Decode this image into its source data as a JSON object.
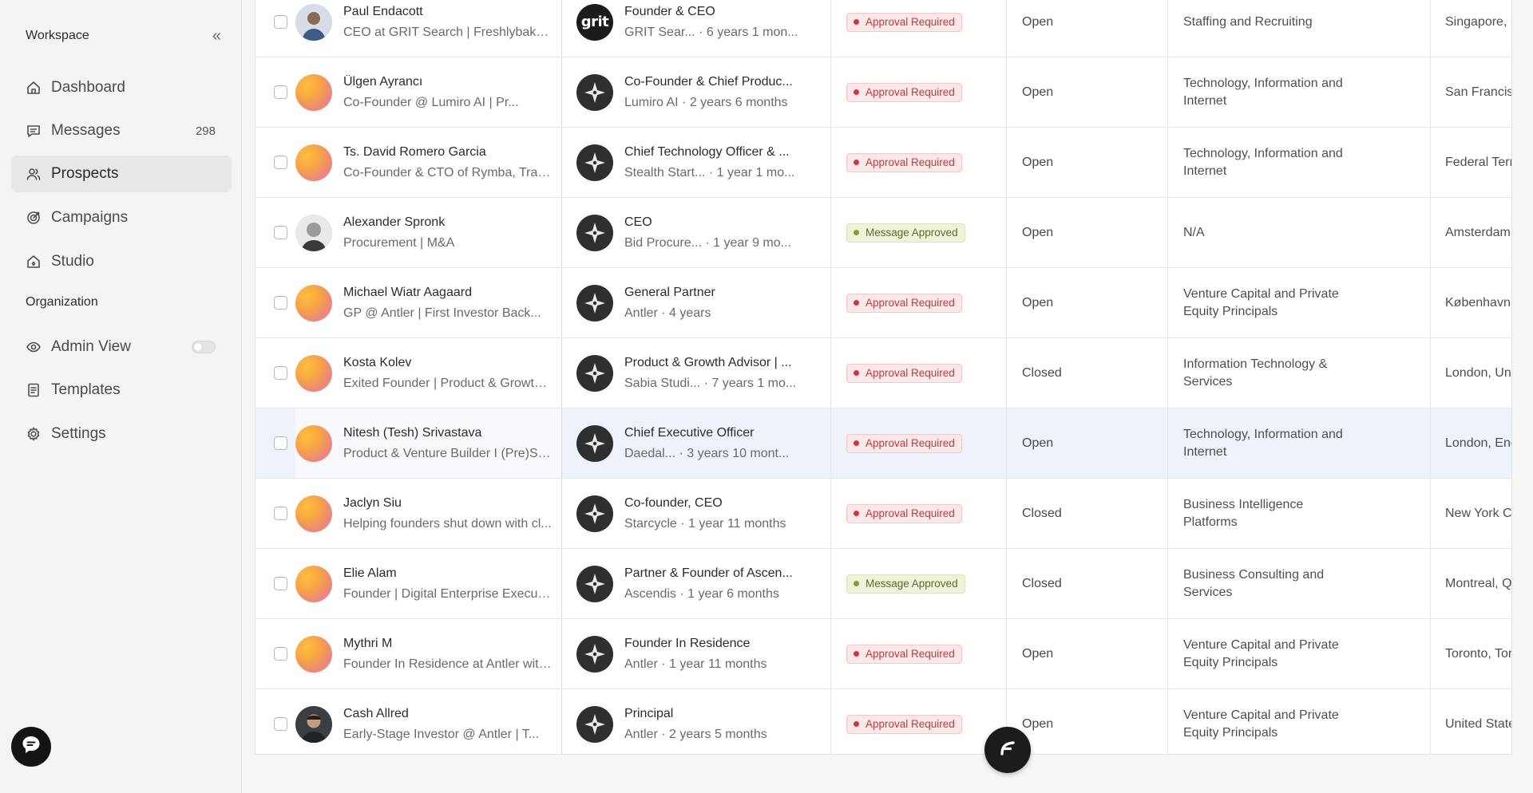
{
  "sidebar": {
    "workspace_label": "Workspace",
    "collapse_glyph": "«",
    "items": [
      {
        "label": "Dashboard",
        "icon": "home-icon"
      },
      {
        "label": "Messages",
        "icon": "message-icon",
        "count": "298"
      },
      {
        "label": "Prospects",
        "icon": "users-icon",
        "active": true
      },
      {
        "label": "Campaigns",
        "icon": "target-icon"
      },
      {
        "label": "Studio",
        "icon": "studio-icon"
      }
    ],
    "org_label": "Organization",
    "org_items": [
      {
        "label": "Admin View",
        "icon": "eye-icon",
        "toggle": false
      },
      {
        "label": "Templates",
        "icon": "document-icon"
      },
      {
        "label": "Settings",
        "icon": "gear-icon"
      }
    ]
  },
  "rows": [
    {
      "name": "Paul Endacott",
      "headline": "CEO at GRIT Search | Freshlybaked...",
      "role": "Founder & CEO",
      "company": "GRIT Sear...",
      "tenure": "· 6 years 1 mon...",
      "status": "Approval Required",
      "state": "Open",
      "industry": "Staffing and Recruiting",
      "location": "Singapore, S"
    },
    {
      "name": "Ülgen Ayrancı",
      "headline": "Co-Founder @ Lumiro AI | Pr...",
      "role": "Co-Founder & Chief Produc...",
      "company": "Lumiro AI",
      "tenure": "· 2 years 6 months",
      "status": "Approval Required",
      "state": "Open",
      "industry": "Technology, Information and Internet",
      "location": "San Francis"
    },
    {
      "name": "Ts. David Romero Garcia",
      "headline": "Co-Founder & CTO of Rymba, Trans...",
      "role": "Chief Technology Officer & ...",
      "company": "Stealth Start...",
      "tenure": "· 1 year 1 mo...",
      "status": "Approval Required",
      "state": "Open",
      "industry": "Technology, Information and Internet",
      "location": "Federal Terr Malaysia"
    },
    {
      "name": "Alexander Spronk",
      "headline": "Procurement | M&A",
      "role": "CEO",
      "company": "Bid Procure...",
      "tenure": "· 1 year 9 mo...",
      "status": "Message Approved",
      "state": "Open",
      "industry": "N/A",
      "location": "Amsterdam Netherlands"
    },
    {
      "name": "Michael Wiatr Aagaard",
      "headline": "GP @ Antler | First Investor Back...",
      "role": "General Partner",
      "company": "Antler",
      "tenure": "· 4 years",
      "status": "Approval Required",
      "state": "Open",
      "industry": "Venture Capital and Private Equity Principals",
      "location": "København"
    },
    {
      "name": "Kosta Kolev",
      "headline": "Exited Founder | Product & Growth ...",
      "role": "Product & Growth Advisor | ...",
      "company": "Sabia Studi...",
      "tenure": "· 7 years 1 mo...",
      "status": "Approval Required",
      "state": "Closed",
      "industry": "Information Technology & Services",
      "location": "London, Uni"
    },
    {
      "name": "Nitesh (Tesh) Srivastava",
      "headline": "Product & Venture Builder I (Pre)Se...",
      "role": "Chief Executive Officer",
      "company": "Daedal...",
      "tenure": "· 3 years 10 mont...",
      "status": "Approval Required",
      "state": "Open",
      "industry": "Technology, Information and Internet",
      "location": "London, Eng"
    },
    {
      "name": "Jaclyn Siu",
      "headline": "Helping founders shut down with cl...",
      "role": "Co-founder, CEO",
      "company": "Starcycle",
      "tenure": "· 1 year 11 months",
      "status": "Approval Required",
      "state": "Closed",
      "industry": "Business Intelligence Platforms",
      "location": "New York C York City M"
    },
    {
      "name": "Elie Alam",
      "headline": "Founder | Digital Enterprise Executi...",
      "role": "Partner & Founder of Ascen...",
      "company": "Ascendis",
      "tenure": "· 1 year 6 months",
      "status": "Message Approved",
      "state": "Closed",
      "industry": "Business Consulting and Services",
      "location": "Montreal, Q"
    },
    {
      "name": "Mythri M",
      "headline": "Founder In Residence at Antler with ...",
      "role": "Founder In Residence",
      "company": "Antler",
      "tenure": "· 1 year 11 months",
      "status": "Approval Required",
      "state": "Open",
      "industry": "Venture Capital and Private Equity Principals",
      "location": "Toronto, Tor"
    },
    {
      "name": "Cash Allred",
      "headline": "Early-Stage Investor @ Antler | T...",
      "role": "Principal",
      "company": "Antler",
      "tenure": "· 2 years 5 months",
      "status": "Approval Required",
      "state": "Open",
      "industry": "Venture Capital and Private Equity Principals",
      "location": "United State"
    }
  ],
  "grit_logo_text": "grit",
  "colors": {
    "approval_required": "#d8333a",
    "message_approved": "#8a9a2e",
    "highlight_row": "#edf2fb"
  }
}
